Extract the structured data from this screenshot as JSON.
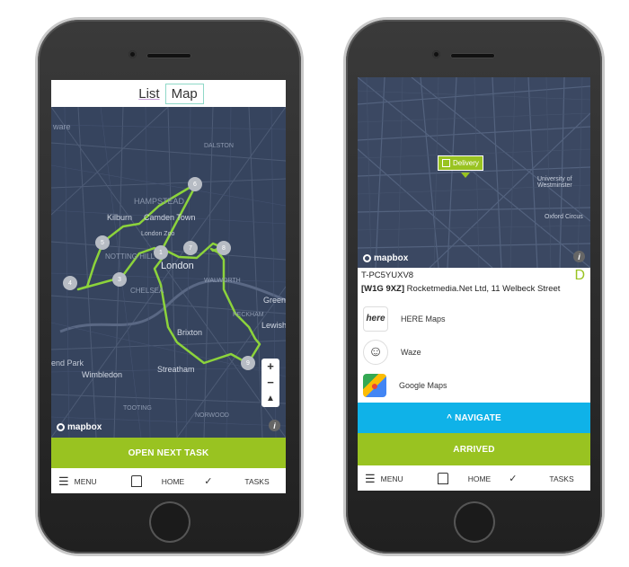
{
  "left": {
    "tabs": [
      {
        "label": "List"
      },
      {
        "label": "Map"
      }
    ],
    "map_labels": {
      "ware": "ware",
      "hampstead": "HAMPSTEAD",
      "kilburn": "Kilburn",
      "camden": "Camden Town",
      "zoo": "London Zoo",
      "london": "London",
      "notting": "NOTTING HILL",
      "chelsea": "CHELSEA",
      "brixton": "Brixton",
      "wimbledon": "Wimbledon",
      "streatham": "Streatham",
      "green": "Green",
      "lewisham": "Lewish",
      "peckham": "PECKHAM",
      "park": "end Park",
      "hackney": "DALSTON",
      "walworth": "WALWORTH",
      "tooting": "TOOTING",
      "norwood": "NORWOOD"
    },
    "markers": [
      {
        "label": "6"
      },
      {
        "label": "7"
      },
      {
        "label": "1"
      },
      {
        "label": "8"
      },
      {
        "label": "5"
      },
      {
        "label": "3"
      },
      {
        "label": "4"
      },
      {
        "label": "9"
      }
    ],
    "zoom": {
      "in": "+",
      "out": "−"
    },
    "mapbox": "mapbox",
    "info": "i",
    "primary_button": "OPEN NEXT TASK",
    "nav": {
      "menu": "MENU",
      "home": "HOME",
      "tasks": "TASKS"
    }
  },
  "right": {
    "map_labels": {
      "pin": "Delivery",
      "university": "University of Westminster",
      "oxford": "Oxford Circus"
    },
    "mapbox": "mapbox",
    "info": "i",
    "task_id": "T-PC5YUXV8",
    "status_letter": "D",
    "postcode": "[W1G 9XZ]",
    "address": "Rocketmedia.Net Ltd, 11 Welbeck Street",
    "apps": [
      {
        "label": "HERE Maps",
        "icon_text": "here"
      },
      {
        "label": "Waze",
        "icon_text": "☺"
      },
      {
        "label": "Google Maps",
        "icon_text": "●"
      }
    ],
    "navigate_button": "^ NAVIGATE",
    "arrived_button": "ARRIVED",
    "nav": {
      "menu": "MENU",
      "home": "HOME",
      "tasks": "TASKS"
    }
  },
  "colors": {
    "green": "#99c321",
    "blue": "#0fb2e8",
    "map_bg": "#36445e",
    "route": "#8cd33b",
    "marker": "#b7bcc4"
  }
}
